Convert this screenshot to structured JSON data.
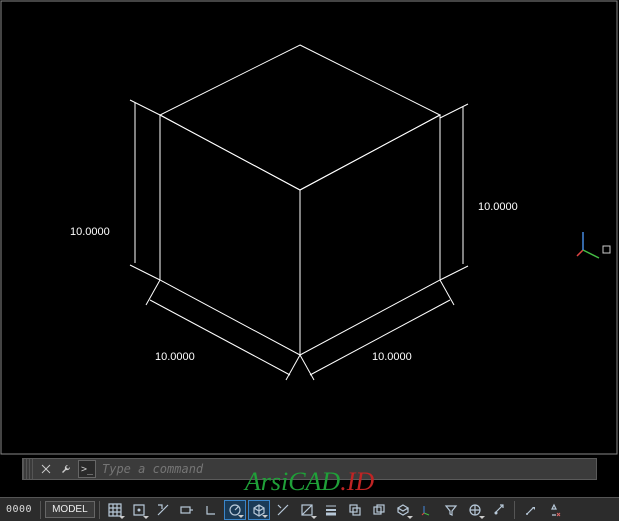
{
  "viewport": {
    "dimensions": {
      "height_left": "10.0000",
      "height_right": "10.0000",
      "width_left": "10.0000",
      "width_right": "10.0000"
    }
  },
  "command_bar": {
    "placeholder": "Type a command"
  },
  "status_bar": {
    "coord": "0000",
    "model_label": "MODEL"
  },
  "watermark": {
    "part1": "ArsiCAD",
    "part2": ".ID"
  }
}
